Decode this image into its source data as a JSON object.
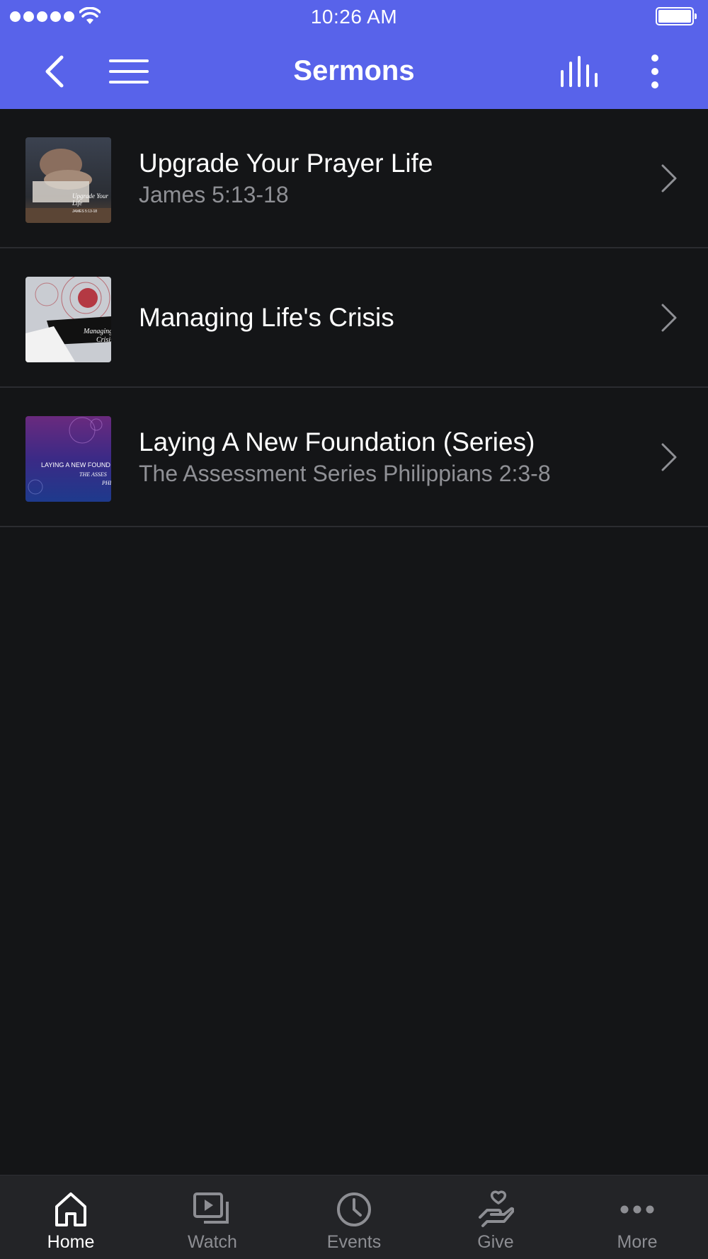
{
  "status_bar": {
    "time": "10:26 AM"
  },
  "nav": {
    "title": "Sermons",
    "icons": [
      "back-icon",
      "menu-icon",
      "equalizer-icon",
      "more-vertical-icon"
    ]
  },
  "colors": {
    "header": "#5863EA",
    "background": "#141517",
    "tab_bar": "#232427",
    "subtitle": "#8F9095",
    "tab_inactive": "#8D8E93"
  },
  "sermons": [
    {
      "title": "Upgrade Your Prayer Life",
      "subtitle": "James 5:13-18",
      "thumb_text": [
        "Upgrade Your",
        "Life",
        "JAMES 5:13-18"
      ]
    },
    {
      "title": "Managing Life's Crisis",
      "subtitle": "",
      "thumb_text": [
        "Managing",
        "Crisis"
      ]
    },
    {
      "title": "Laying A New Foundation (Series)",
      "subtitle": "The Assessment Series Philippians 2:3-8",
      "thumb_text": [
        "LAYING A NEW FOUND",
        "THE ASSES",
        "PHI"
      ]
    }
  ],
  "tabs": [
    {
      "label": "Home",
      "icon": "home-icon",
      "active": true
    },
    {
      "label": "Watch",
      "icon": "watch-icon",
      "active": false
    },
    {
      "label": "Events",
      "icon": "clock-icon",
      "active": false
    },
    {
      "label": "Give",
      "icon": "give-icon",
      "active": false
    },
    {
      "label": "More",
      "icon": "more-horizontal-icon",
      "active": false
    }
  ]
}
